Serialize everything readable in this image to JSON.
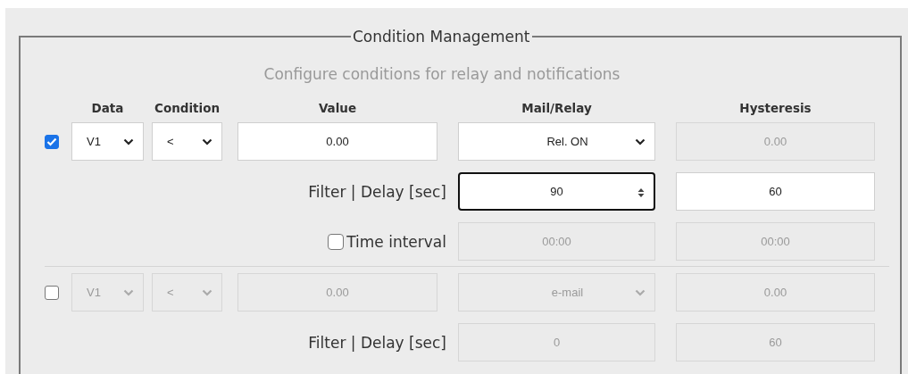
{
  "panel": {
    "legend": "Condition Management",
    "subtitle": "Configure conditions for relay and notifications"
  },
  "columns": [
    "Data",
    "Condition",
    "Value",
    "Mail/Relay",
    "Hysteresis"
  ],
  "conditions": [
    {
      "checked": true,
      "data": {
        "kind": "select",
        "value": "V1",
        "disabled": false
      },
      "condition": {
        "kind": "select",
        "value": "<",
        "disabled": false
      },
      "value": {
        "value": "0.00",
        "disabled": false
      },
      "mail_relay": {
        "kind": "select",
        "value": "Rel. ON",
        "disabled": false
      },
      "hysteresis": {
        "value": "0.00",
        "disabled": true
      },
      "filter": {
        "label": "Filter | Delay [sec]",
        "delay": {
          "value": "90",
          "disabled": false,
          "focused": true
        },
        "hysteresis": {
          "value": "60",
          "disabled": false,
          "focused": false
        }
      },
      "time_interval": {
        "label": "Time interval",
        "checked": false,
        "start": {
          "value": "00:00",
          "disabled": true
        },
        "end": {
          "value": "00:00",
          "disabled": true
        }
      }
    },
    {
      "checked": false,
      "data": {
        "kind": "select",
        "value": "V1",
        "disabled": true
      },
      "condition": {
        "kind": "select",
        "value": "<",
        "disabled": true
      },
      "value": {
        "value": "0.00",
        "disabled": true
      },
      "mail_relay": {
        "kind": "select",
        "value": "e-mail",
        "disabled": true
      },
      "hysteresis": {
        "value": "0.00",
        "disabled": true
      },
      "filter": {
        "label": "Filter | Delay [sec]",
        "delay": {
          "value": "0",
          "disabled": true,
          "focused": false
        },
        "hysteresis": {
          "value": "60",
          "disabled": true,
          "focused": false
        }
      }
    }
  ]
}
